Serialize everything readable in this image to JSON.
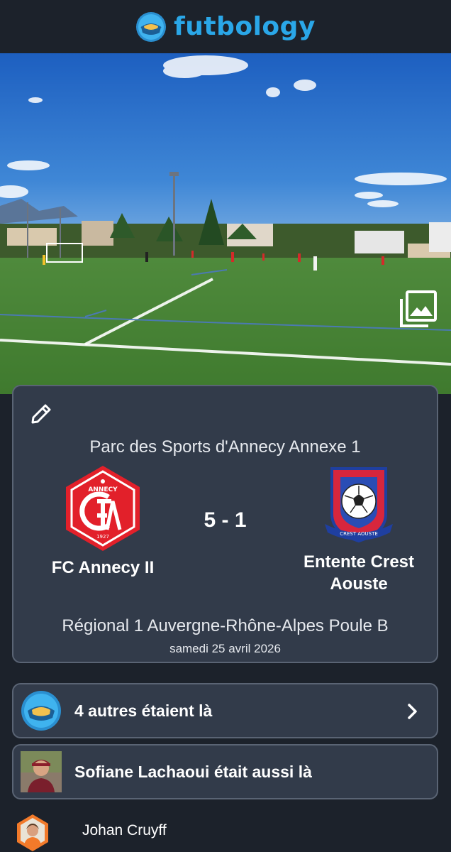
{
  "app": {
    "brand_name": "futbology"
  },
  "photo": {
    "icon": "gallery-icon"
  },
  "match": {
    "venue": "Parc des Sports d'Annecy Annexe 1",
    "home_team": {
      "name": "FC Annecy II",
      "crest_text_top": "ANNECY",
      "crest_text_bottom": "1927"
    },
    "away_team": {
      "name_line1": "Entente Crest",
      "name_line2": "Aouste",
      "crest_text": "CREST AOUSTE"
    },
    "score": "5 - 1",
    "competition": "Régional 1 Auvergne-Rhône-Alpes Poule B",
    "date": "samedi 25 avril 2026",
    "edit_icon": "pencil-icon"
  },
  "attendance": {
    "others_label": "4 autres étaient là",
    "friend_label": "Sofiane Lachaoui était aussi là"
  },
  "footer": {
    "user_name": "Johan Cruyff"
  },
  "colors": {
    "accent": "#2aa7e8",
    "background": "#1c222b",
    "card": "#323b4a",
    "card_border": "#5a6474",
    "annecy_red": "#e2202a"
  }
}
